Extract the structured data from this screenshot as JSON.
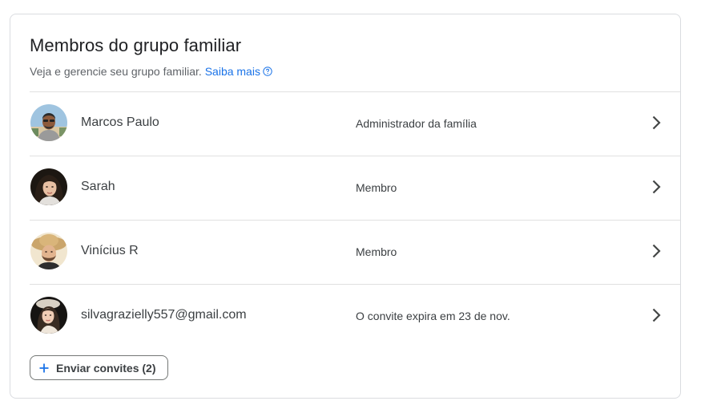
{
  "card": {
    "title": "Membros do grupo familiar",
    "subtitle": "Veja e gerencie seu grupo familiar.",
    "learn_more": "Saiba mais",
    "help_icon": "help-circle-icon"
  },
  "members": [
    {
      "name": "Marcos Paulo",
      "role": "Administrador da família",
      "avatar": "avatar-photo"
    },
    {
      "name": "Sarah",
      "role": "Membro",
      "avatar": "avatar-photo"
    },
    {
      "name": "Vinícius R",
      "role": "Membro",
      "avatar": "avatar-photo"
    },
    {
      "name": "silvagrazielly557@gmail.com",
      "role": "O convite expira em 23 de nov.",
      "avatar": "avatar-photo"
    }
  ],
  "invite_button": {
    "label": "Enviar convites (2)",
    "icon": "plus-icon"
  },
  "colors": {
    "link": "#1a73e8",
    "border": "#dadce0",
    "divider": "#e0e0e0",
    "text": "#3c4043"
  }
}
